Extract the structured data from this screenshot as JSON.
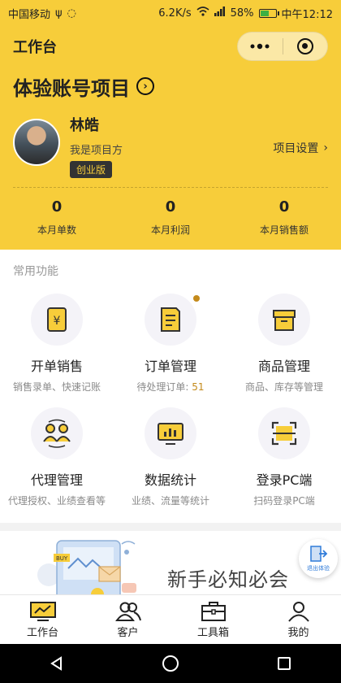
{
  "status_bar": {
    "carrier": "中国移动",
    "net_speed": "6.2K/s",
    "battery": "58%",
    "battery_level": 0.58,
    "time": "中午12:12"
  },
  "app_bar": {
    "title": "工作台"
  },
  "project": {
    "name": "体验账号项目",
    "user_name": "林皓",
    "role": "我是项目方",
    "edition_badge": "创业版",
    "settings_label": "项目设置"
  },
  "stats": [
    {
      "value": "0",
      "label": "本月单数"
    },
    {
      "value": "0",
      "label": "本月利润"
    },
    {
      "value": "0",
      "label": "本月销售额"
    }
  ],
  "functions": {
    "title": "常用功能",
    "items": [
      {
        "name": "开单销售",
        "desc": "销售录单、快速记账",
        "icon": "yuan-tag-icon"
      },
      {
        "name": "订单管理",
        "desc": "待处理订单: ",
        "count": "51",
        "icon": "order-list-icon"
      },
      {
        "name": "商品管理",
        "desc": "商品、库存等管理",
        "icon": "box-icon"
      },
      {
        "name": "代理管理",
        "desc": "代理授权、业绩查看等",
        "icon": "users-swap-icon"
      },
      {
        "name": "数据统计",
        "desc": "业绩、流量等统计",
        "icon": "bar-chart-icon"
      },
      {
        "name": "登录PC端",
        "desc": "扫码登录PC端",
        "icon": "scan-icon"
      }
    ]
  },
  "banner": {
    "text": "新手必知必会",
    "buy_label": "BUY"
  },
  "exit_float": {
    "label": "退出体验"
  },
  "tab_bar": {
    "items": [
      {
        "label": "工作台",
        "icon": "monitor-icon"
      },
      {
        "label": "客户",
        "icon": "customers-icon"
      },
      {
        "label": "工具箱",
        "icon": "toolbox-icon"
      },
      {
        "label": "我的",
        "icon": "person-icon"
      }
    ]
  },
  "colors": {
    "brand_yellow": "#f7cd3a",
    "accent_gold": "#c48a1b",
    "dark": "#333333"
  }
}
